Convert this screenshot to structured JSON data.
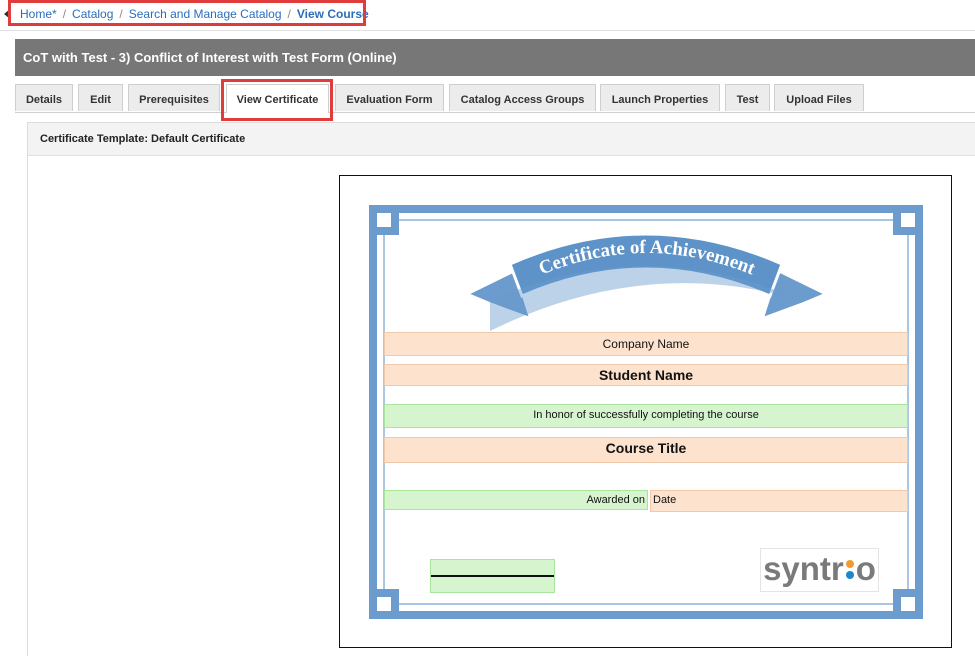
{
  "breadcrumb": {
    "items": [
      "Home*",
      "Catalog",
      "Search and Manage Catalog"
    ],
    "separator": "/",
    "current": "View Course"
  },
  "page_title": "CoT with Test - 3) Conflict of Interest with Test Form (Online)",
  "tabs": [
    {
      "label": "Details"
    },
    {
      "label": "Edit"
    },
    {
      "label": "Prerequisites"
    },
    {
      "label": "View Certificate",
      "active": true
    },
    {
      "label": "Evaluation Form"
    },
    {
      "label": "Catalog Access Groups"
    },
    {
      "label": "Launch Properties"
    },
    {
      "label": "Test"
    },
    {
      "label": "Upload Files"
    }
  ],
  "certificate": {
    "template_label": "Certificate Template: Default Certificate",
    "banner_text": "Certificate of Achievement",
    "company_name": "Company Name",
    "student_name": "Student Name",
    "honor_text": "In honor of successfully completing the course",
    "course_title": "Course Title",
    "awarded_on_label": "Awarded on",
    "date_label": "Date",
    "logo_text_start": "syntr",
    "logo_text_end": "o"
  },
  "colors": {
    "link": "#2a6ebb",
    "highlight_box": "#e03c3c",
    "title_bar": "#777777",
    "frame_blue": "#6b9ccd",
    "field_orange": "#fde2cd",
    "field_green": "#d6f5cf",
    "logo_orange": "#f29a2e",
    "logo_blue": "#1e87c8"
  },
  "icons": {
    "back": "caret-left-icon"
  }
}
